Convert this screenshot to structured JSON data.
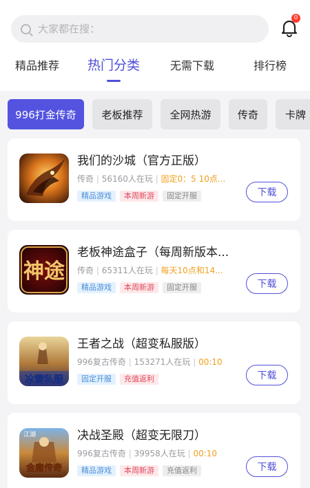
{
  "search": {
    "placeholder": "大家都在搜："
  },
  "notification": {
    "badge": "0"
  },
  "tabs": [
    {
      "label": "精品推荐"
    },
    {
      "label": "热门分类"
    },
    {
      "label": "无需下载"
    },
    {
      "label": "排行榜"
    }
  ],
  "chips": [
    {
      "label": "996打金传奇"
    },
    {
      "label": "老板推荐"
    },
    {
      "label": "全网热游"
    },
    {
      "label": "传奇"
    },
    {
      "label": "卡牌"
    }
  ],
  "games": [
    {
      "name": "我们的沙城（官方正版）",
      "genre": "传奇",
      "players": "56160人在玩",
      "schedule": "固定0：5 10点...",
      "tags": [
        "精品游戏",
        "本周新游",
        "固定开服"
      ],
      "download": "下载"
    },
    {
      "name": "老板神途盒子（每周新版本...",
      "genre": "传奇",
      "players": "65311人在玩",
      "schedule": "每天10点和14...",
      "tags": [
        "精品游戏",
        "本周新游",
        "固定开服"
      ],
      "download": "下载"
    },
    {
      "name": "王者之战（超变私服版）",
      "genre": "996复古传奇",
      "players": "153271人在玩",
      "schedule": "00:10",
      "tags": [
        "固定开服",
        "充值返利"
      ],
      "download": "下载"
    },
    {
      "name": "决战圣殿（超变无限刀）",
      "genre": "996复古传奇",
      "players": "39958人在玩",
      "schedule": "00:10",
      "tags": [
        "精品游戏",
        "本周新游",
        "充值返利"
      ],
      "download": "下载"
    }
  ],
  "icon_text": {
    "game2": "神途",
    "game3": "冰雪私服",
    "game4": "金庸传奇",
    "game4_corner": "江湖"
  },
  "colors": {
    "accent": "#4f4fd8",
    "chip_active": "#5353e0",
    "schedule": "#f0a020"
  }
}
